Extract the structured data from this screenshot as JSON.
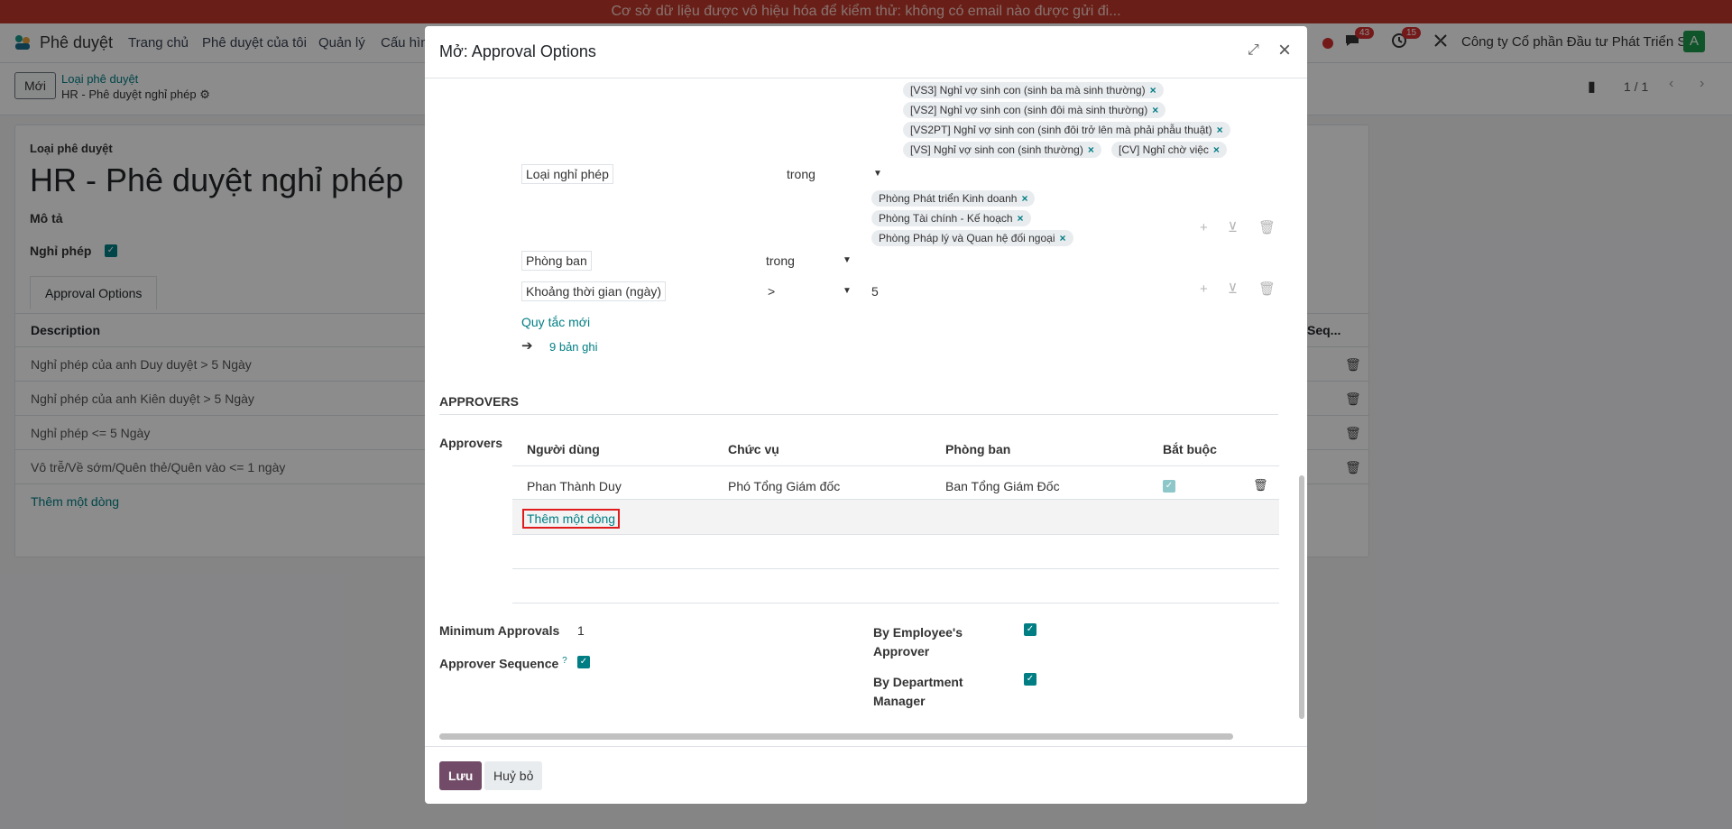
{
  "banner": {
    "text": "Cơ sở dữ liệu được vô hiệu hóa để kiểm thử: không có email nào được gửi đi..."
  },
  "topbar": {
    "app_name": "Phê duyệt",
    "menu": [
      "Trang chủ",
      "Phê duyệt của tôi",
      "Quản lý",
      "Cấu hìn"
    ],
    "chat_count": "43",
    "activity_count": "15",
    "company": "Công ty Cổ phần Đầu tư Phát Triển S...",
    "avatar": "A"
  },
  "control": {
    "new_label": "Mới",
    "breadcrumb_parent": "Loại phê duyệt",
    "breadcrumb_current": "HR - Phê duyệt nghỉ phép",
    "pager": "1 / 1"
  },
  "sheet": {
    "type_label": "Loại phê duyệt",
    "title": "HR - Phê duyệt nghỉ phép",
    "desc_label": "Mô tả",
    "leave_label": "Nghỉ phép",
    "tab": "Approval Options",
    "col_description": "Description",
    "col_seq": "Seq...",
    "rows": [
      "Nghỉ phép của anh Duy duyệt > 5 Ngày",
      "Nghỉ phép của anh Kiên duyệt > 5 Ngày",
      "Nghỉ phép <= 5 Ngày",
      "Vô trễ/Về sớm/Quên thẻ/Quên vào <= 1 ngày"
    ],
    "add_line": "Thêm một dòng"
  },
  "modal": {
    "title": "Mở: Approval Options",
    "leave_tags": [
      "[VS3] Nghỉ vợ sinh con (sinh ba mà sinh thường)",
      "[VS2] Nghỉ vợ sinh con (sinh đôi mà sinh thường)",
      "[VS2PT] Nghỉ vợ sinh con (sinh đôi trở lên mà phải phẫu thuật)",
      "[VS] Nghỉ vợ sinh con (sinh thường)",
      "[CV] Nghỉ chờ việc"
    ],
    "rule1": {
      "field": "Loại nghỉ phép",
      "op": "trong"
    },
    "dept_tags": [
      "Phòng Phát triển Kinh doanh",
      "Phòng Tài chính - Kế hoạch",
      "Phòng Pháp lý và Quan hệ đối ngoại"
    ],
    "rule2": {
      "field": "Phòng ban",
      "op": "trong"
    },
    "rule3": {
      "field": "Khoảng thời gian (ngày)",
      "op": ">",
      "value": "5"
    },
    "new_rule": "Quy tắc mới",
    "records": "9 bản ghi",
    "approvers_section": "APPROVERS",
    "approvers_label": "Approvers",
    "columns": {
      "user": "Người dùng",
      "position": "Chức vụ",
      "department": "Phòng ban",
      "required": "Bắt buộc"
    },
    "approver_row": {
      "user": "Phan Thành Duy",
      "position": "Phó Tổng Giám đốc",
      "department": "Ban Tổng Giám Đốc",
      "required": true
    },
    "add_line": "Thêm một dòng",
    "min_approvals_label": "Minimum Approvals",
    "min_approvals_value": "1",
    "sequence_label": "Approver Sequence",
    "sequence_help": "?",
    "by_emp_label1": "By Employee's",
    "by_emp_label2": "Approver",
    "by_dept_label1": "By Department",
    "by_dept_label2": "Manager",
    "save": "Lưu",
    "cancel": "Huỷ bỏ"
  }
}
